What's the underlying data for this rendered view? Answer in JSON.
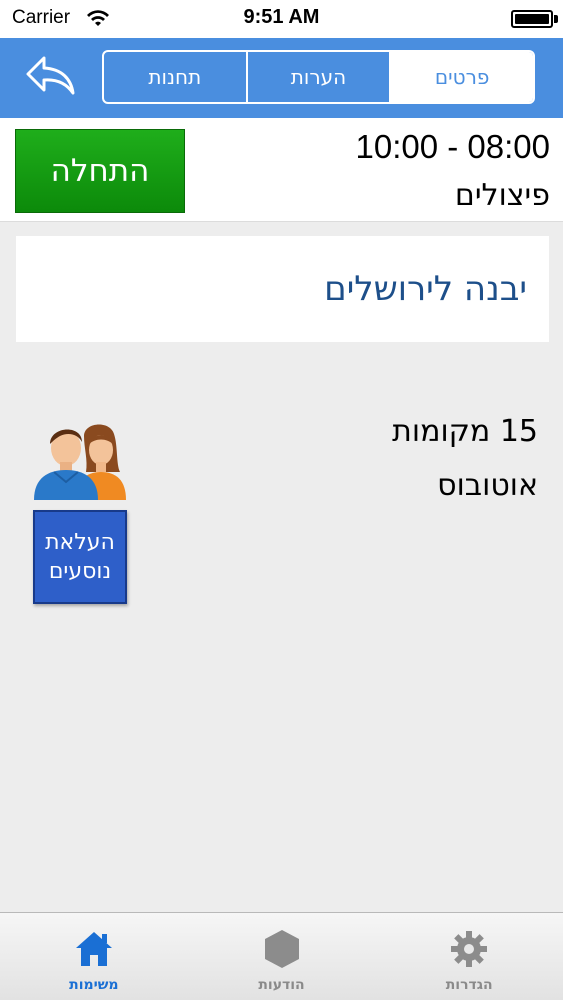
{
  "status_bar": {
    "carrier": "Carrier",
    "time": "9:51 AM"
  },
  "nav": {
    "back_icon": "reply-arrow-icon",
    "segments": [
      {
        "label": "פרטים",
        "active": true
      },
      {
        "label": "הערות",
        "active": false
      },
      {
        "label": "תחנות",
        "active": false
      }
    ]
  },
  "trip": {
    "time_range": "10:00 - 08:00",
    "category": "פיצולים",
    "start_button": "התחלה",
    "route_title": "יבנה לירושלים",
    "seats": "15 מקומות",
    "vehicle": "אוטובוס",
    "board_button_line1": "העלאת",
    "board_button_line2": "נוסעים"
  },
  "tab_bar": {
    "tabs": [
      {
        "label": "משימות",
        "icon": "home-icon",
        "active": true
      },
      {
        "label": "הודעות",
        "icon": "hexagon-icon",
        "active": false
      },
      {
        "label": "הגדרות",
        "icon": "gear-icon",
        "active": false
      }
    ]
  },
  "colors": {
    "nav": "#4a8edf",
    "start_button": "#17a014",
    "board_button": "#2e5fc9",
    "route_title": "#1d4f8a",
    "active_tab": "#1a6fd4"
  }
}
